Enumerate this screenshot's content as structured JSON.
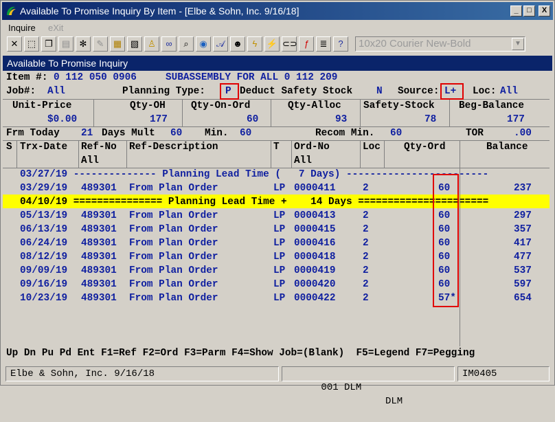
{
  "window": {
    "title": "Available To Promise Inquiry By Item - [Elbe & Sohn, Inc. 9/16/18]",
    "min_label": "_",
    "max_label": "□",
    "close_label": "X"
  },
  "menu": {
    "inquire": "Inquire",
    "exit": "eXit"
  },
  "toolbar": {
    "font_combo": "10x20 Courier New-Bold"
  },
  "panel": {
    "title": "Available To Promise Inquiry"
  },
  "item": {
    "item_label": "Item #:",
    "item_number": "0 112 050 0906",
    "description": "SUBASSEMBLY FOR ALL 0 112 209",
    "job_label": "Job#:",
    "job_value": "All",
    "planning_label": "Planning Type:",
    "planning_value": "P",
    "deduct_label": "Deduct Safety Stock",
    "deduct_value": "N",
    "source_label": "Source:",
    "source_value": "L+",
    "loc_label": "Loc:",
    "loc_value": "All"
  },
  "summary": {
    "headers": [
      "Unit-Price",
      "Qty-OH",
      "Qty-On-Ord",
      "Qty-Alloc",
      "Safety-Stock",
      "Beg-Balance"
    ],
    "values": [
      "$0.00",
      "177",
      "60",
      "93",
      "78",
      "177"
    ]
  },
  "params": {
    "frm_label": "Frm Today",
    "days_value": "21",
    "days_mult_label": "Days Mult",
    "mult_value": "60",
    "min_label": "Min.",
    "min_value": "60",
    "recom_label": "Recom Min.",
    "recom_value": "60",
    "tor_label": "TOR",
    "tor_value": ".00"
  },
  "columns": {
    "s": "S",
    "trx_date": "Trx-Date",
    "ref_no": "Ref-No",
    "ref_no_sub": "All",
    "ref_desc": "Ref-Description",
    "t": "T",
    "ord_no": "Ord-No",
    "ord_no_sub": "All",
    "loc": "Loc",
    "qty_ord": "Qty-Ord",
    "balance": "Balance"
  },
  "lead_row": "03/27/19 -------------- Planning Lead Time (   7 Days) ------------------------",
  "highlight_row": "04/10/19 =============== Planning Lead Time +    14 Days ======================",
  "rows": [
    {
      "date": "03/29/19",
      "ref": "489301",
      "desc": "From Plan Order",
      "t": "LP",
      "ord": "0000411",
      "loc": "2",
      "qty": "60",
      "bal": "237"
    },
    {
      "date": "05/13/19",
      "ref": "489301",
      "desc": "From Plan Order",
      "t": "LP",
      "ord": "0000413",
      "loc": "2",
      "qty": "60",
      "bal": "297"
    },
    {
      "date": "06/13/19",
      "ref": "489301",
      "desc": "From Plan Order",
      "t": "LP",
      "ord": "0000415",
      "loc": "2",
      "qty": "60",
      "bal": "357"
    },
    {
      "date": "06/24/19",
      "ref": "489301",
      "desc": "From Plan Order",
      "t": "LP",
      "ord": "0000416",
      "loc": "2",
      "qty": "60",
      "bal": "417"
    },
    {
      "date": "08/12/19",
      "ref": "489301",
      "desc": "From Plan Order",
      "t": "LP",
      "ord": "0000418",
      "loc": "2",
      "qty": "60",
      "bal": "477"
    },
    {
      "date": "09/09/19",
      "ref": "489301",
      "desc": "From Plan Order",
      "t": "LP",
      "ord": "0000419",
      "loc": "2",
      "qty": "60",
      "bal": "537"
    },
    {
      "date": "09/16/19",
      "ref": "489301",
      "desc": "From Plan Order",
      "t": "LP",
      "ord": "0000420",
      "loc": "2",
      "qty": "60",
      "bal": "597"
    },
    {
      "date": "10/23/19",
      "ref": "489301",
      "desc": "From Plan Order",
      "t": "LP",
      "ord": "0000422",
      "loc": "2",
      "qty": "57*",
      "bal": "654"
    }
  ],
  "function_keys": "Up Dn Pu Pd Ent F1=Ref F2=Ord F3=Parm F4=Show Job=(Blank)  F5=Legend F7=Pegging",
  "status": {
    "company": "Elbe & Sohn, Inc. 9/16/18",
    "user": "001 DLM",
    "user2": "DLM",
    "program": "IM0405"
  },
  "colors": {
    "title_bar": "#0a246a",
    "highlight": "#ffff00",
    "text_blue": "#1020a0",
    "annotation_red": "#e00000"
  }
}
